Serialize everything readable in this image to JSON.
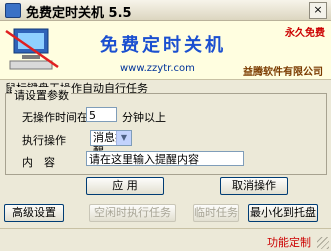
{
  "window": {
    "title": "免费定时关机 5.5",
    "close": "×"
  },
  "banner": {
    "title": "免费定时关机",
    "permanent_note": "永久免费",
    "website": "www.zzytr.com",
    "company": "益腾软件有限公司"
  },
  "section": {
    "caption": "鼠标键盘无操作自动自行任务"
  },
  "settings": {
    "caption": "请设置参数",
    "idle_label": "无操作时间在",
    "idle_value": "5",
    "idle_unit": "分钟以上",
    "action_label": "执行操作",
    "action_selected": "消息提醒",
    "content_label": "内　容",
    "content_value": "请在这里输入提醒内容"
  },
  "buttons": {
    "apply": "应  用",
    "cancel": "取消操作",
    "advanced": "高级设置",
    "idle_task": "空闲时执行任务",
    "temp_task": "临时任务",
    "minimize_tray": "最小化到托盘"
  },
  "status": {
    "custom": "功能定制"
  }
}
